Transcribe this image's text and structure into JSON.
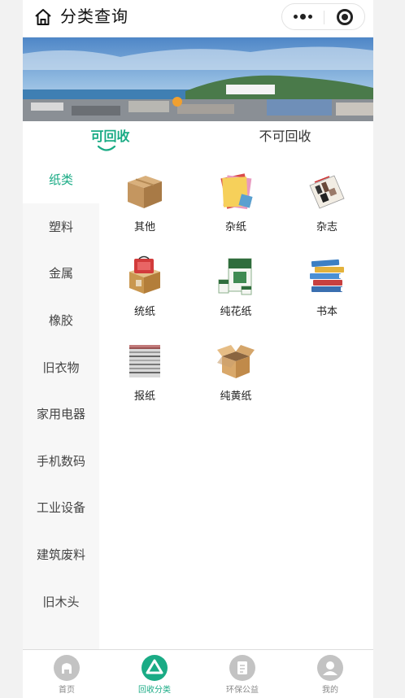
{
  "header": {
    "title": "分类查询"
  },
  "tabs": [
    {
      "label": "可回收",
      "active": true
    },
    {
      "label": "不可回收",
      "active": false
    }
  ],
  "sidebar": {
    "items": [
      {
        "label": "纸类",
        "active": true
      },
      {
        "label": "塑料"
      },
      {
        "label": "金属"
      },
      {
        "label": "橡胶"
      },
      {
        "label": "旧衣物"
      },
      {
        "label": "家用电器"
      },
      {
        "label": "手机数码"
      },
      {
        "label": "工业设备"
      },
      {
        "label": "建筑废料"
      },
      {
        "label": "旧木头"
      }
    ]
  },
  "grid": {
    "items": [
      {
        "label": "其他",
        "icon": "cardboard-box-icon"
      },
      {
        "label": "杂纸",
        "icon": "mixed-paper-icon"
      },
      {
        "label": "杂志",
        "icon": "magazine-icon"
      },
      {
        "label": "统纸",
        "icon": "packaging-box-icon"
      },
      {
        "label": "纯花纸",
        "icon": "milk-carton-icon"
      },
      {
        "label": "书本",
        "icon": "book-stack-icon"
      },
      {
        "label": "报纸",
        "icon": "newspaper-stack-icon"
      },
      {
        "label": "纯黄纸",
        "icon": "open-box-icon"
      }
    ]
  },
  "tabbar": {
    "items": [
      {
        "label": "首页",
        "icon": "home-icon"
      },
      {
        "label": "回收分类",
        "icon": "recycle-icon",
        "active": true
      },
      {
        "label": "环保公益",
        "icon": "document-icon"
      },
      {
        "label": "我的",
        "icon": "user-icon"
      }
    ]
  },
  "colors": {
    "accent": "#1aab85",
    "inactive_icon": "#c3c3c3"
  }
}
